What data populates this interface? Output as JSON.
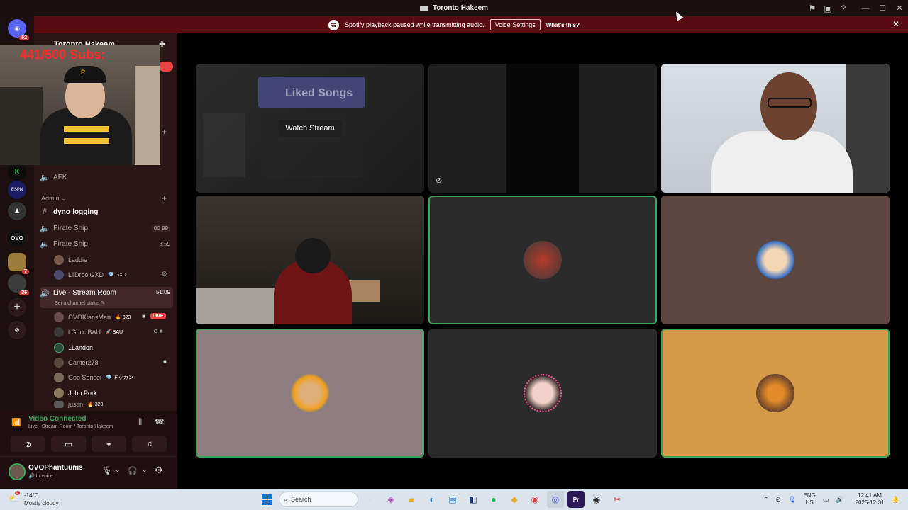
{
  "window": {
    "title": "Toronto Hakeem"
  },
  "notice": {
    "message": "Spotify playback paused while transmitting audio.",
    "voice_settings_label": "Voice Settings",
    "whats_this_label": "What's this?"
  },
  "rail": {
    "home_badge": "62",
    "server_badge_1": "7",
    "server_badge_2": "36"
  },
  "overlay": {
    "subs_text": "441/500  Subs:"
  },
  "sidebar": {
    "server_name": "Toronto Hakeem",
    "afk_channel": "AFK",
    "admin_category": "Admin",
    "channels": [
      {
        "name": "dyno-logging",
        "meta": ""
      },
      {
        "name": "Pirate Ship",
        "meta": "00  99"
      },
      {
        "name": "Pirate Ship",
        "meta": "8:59"
      }
    ],
    "pirate_members": [
      "Laddie",
      "LilDroolGXD"
    ],
    "pirate_member_tag": "GXD",
    "live_channel": "Live - Stream Room",
    "live_timer": "51:09",
    "channel_status": "Set a channel status",
    "live_members": [
      {
        "name": "OVOKlansMan",
        "tag": "323",
        "live": "LIVE"
      },
      {
        "name": "l GucciBAU",
        "tag": "BAU",
        "live": ""
      },
      {
        "name": "1Landon",
        "tag": "",
        "live": ""
      },
      {
        "name": "Gamer278",
        "tag": "",
        "live": ""
      },
      {
        "name": "Goo Sensei",
        "tag": "ドッカン",
        "live": ""
      },
      {
        "name": "John Pork",
        "tag": "",
        "live": ""
      },
      {
        "name": "justin",
        "tag": "323",
        "live": ""
      }
    ]
  },
  "voice": {
    "status": "Video Connected",
    "location": "Live - Stream Room / Toronto Hakeem"
  },
  "user": {
    "name": "OVOPhantuums",
    "status": "In voice"
  },
  "panel": {
    "watch_stream_label": "Watch Stream",
    "stream_preview_title": "Liked Songs"
  },
  "taskbar": {
    "weather_temp": "-14°C",
    "weather_desc": "Mostly cloudy",
    "weather_badge": "3",
    "search_placeholder": "Search",
    "lang_1": "ENG",
    "lang_2": "US",
    "time": "12:41 AM",
    "date": "2025-12-31"
  },
  "colors": {
    "banner": "#5a0d10",
    "sidebar": "#2a1517",
    "speaking": "#3ba55d",
    "live": "#ed4245",
    "tile_orange": "#d49a48",
    "tile_mauve": "#8e7e81",
    "tile_brown": "#5d4540"
  }
}
